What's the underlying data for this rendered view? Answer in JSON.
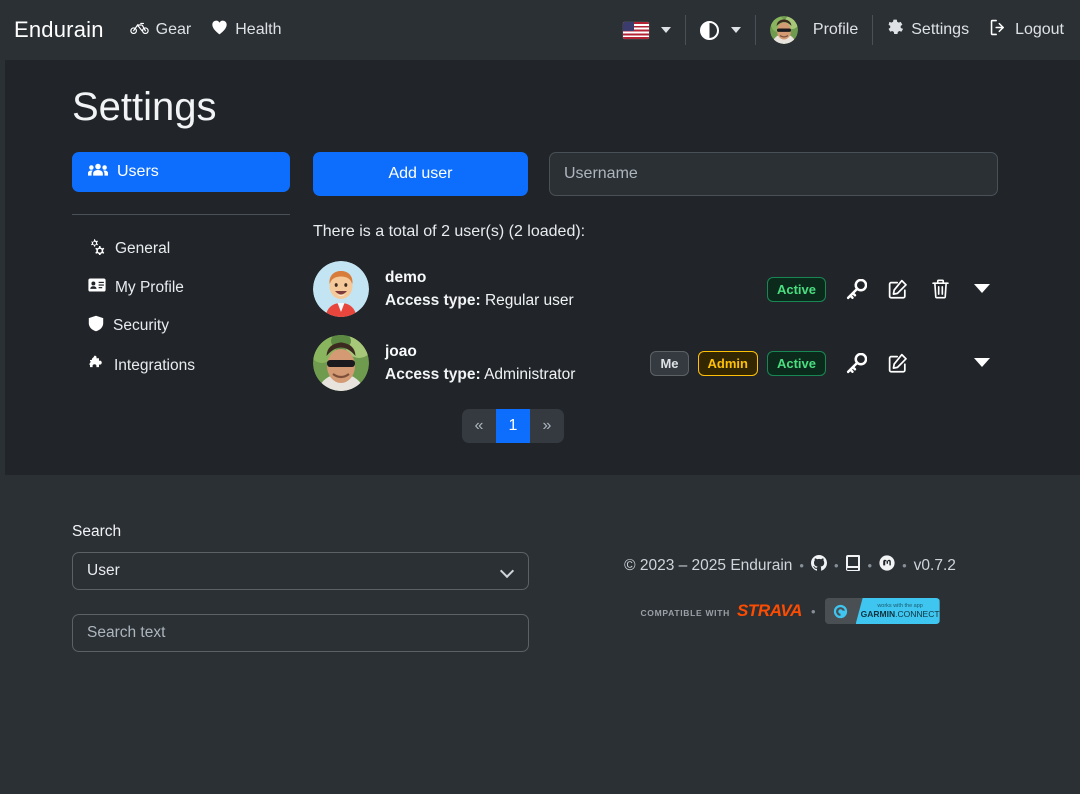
{
  "header": {
    "brand": "Endurain",
    "nav": [
      {
        "label": "Gear",
        "icon": "bicycle-icon"
      },
      {
        "label": "Health",
        "icon": "heart-icon"
      }
    ],
    "language": {
      "flag": "us-flag-icon",
      "caret": "chevron-down-icon"
    },
    "theme": {
      "icon": "theme-contrast-icon",
      "caret": "chevron-down-icon"
    },
    "profile": {
      "label": "Profile",
      "avatar": "user-avatar"
    },
    "settings": {
      "label": "Settings",
      "icon": "gear-icon"
    },
    "logout": {
      "label": "Logout",
      "icon": "logout-icon"
    }
  },
  "main": {
    "title": "Settings",
    "sidebar": {
      "active_item": {
        "label": "Users",
        "icon": "users-icon"
      },
      "items": [
        {
          "label": "General",
          "icon": "gears-icon"
        },
        {
          "label": "My Profile",
          "icon": "id-card-icon"
        },
        {
          "label": "Security",
          "icon": "shield-icon"
        },
        {
          "label": "Integrations",
          "icon": "puzzle-piece-icon"
        }
      ]
    },
    "toolbar": {
      "add_user_label": "Add user",
      "username_placeholder": "Username",
      "username_value": ""
    },
    "total_text": "There is a total of 2 user(s) (2 loaded):",
    "users": [
      {
        "name": "demo",
        "access_label": "Access type:",
        "access_value": "Regular user",
        "badges": [
          {
            "text": "Active",
            "style": "active"
          }
        ],
        "actions": [
          "key-icon",
          "edit-icon",
          "trash-icon",
          "chevron-down-icon"
        ]
      },
      {
        "name": "joao",
        "access_label": "Access type:",
        "access_value": "Administrator",
        "badges": [
          {
            "text": "Me",
            "style": "me"
          },
          {
            "text": "Admin",
            "style": "admin"
          },
          {
            "text": "Active",
            "style": "active"
          }
        ],
        "actions": [
          "key-icon",
          "edit-icon",
          "chevron-down-icon"
        ]
      }
    ],
    "pagination": {
      "prev": "«",
      "current": "1",
      "next": "»"
    }
  },
  "footer": {
    "search": {
      "label": "Search",
      "select_value": "User",
      "text_placeholder": "Search text",
      "text_value": ""
    },
    "copyright": "© 2023 – 2025 Endurain",
    "version": "v0.7.2",
    "links": [
      "github-icon",
      "book-icon",
      "mastodon-icon"
    ],
    "separator": "•",
    "strava": {
      "compatible_with": "COMPATIBLE WITH",
      "name": "STRAVA"
    },
    "garmin": {
      "top": "works with the app",
      "brand": "GARMIN",
      "suffix": ".CONNECT"
    }
  },
  "colors": {
    "accent_blue": "#0d6efd",
    "page_bg": "#2b3035",
    "main_bg": "#212529",
    "badge_active": "#4ade80",
    "badge_admin": "#ffc107",
    "strava_orange": "#fc4c02",
    "garmin_cyan": "#3ec6f0"
  }
}
